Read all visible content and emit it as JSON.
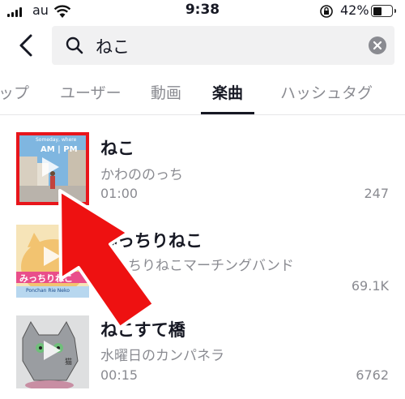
{
  "status_bar": {
    "carrier": "au",
    "time": "9:38",
    "battery_pct": "42%",
    "battery_level": 0.42,
    "icons": [
      "signal-icon",
      "wifi-icon",
      "orientation-lock-icon",
      "battery-icon"
    ]
  },
  "search": {
    "query": "ねこ",
    "icons": [
      "back-icon",
      "search-icon",
      "clear-icon"
    ]
  },
  "tabs": [
    {
      "label": "ップ",
      "active": false
    },
    {
      "label": "ユーザー",
      "active": false
    },
    {
      "label": "動画",
      "active": false
    },
    {
      "label": "楽曲",
      "active": true
    },
    {
      "label": "ハッシュタグ",
      "active": false
    }
  ],
  "songs": [
    {
      "title": "ねこ",
      "artist": "かわののっち",
      "duration": "01:00",
      "count": "247",
      "cover_text": "AM | PM",
      "cover_small": "Someday, where"
    },
    {
      "title": "みっちりねこ",
      "artist": "みっちりねこマーチングバンド",
      "duration": "",
      "count": "69.1K",
      "cover_text": "みっちりねこ",
      "cover_small": "Ponchan Rie Neko"
    },
    {
      "title": "ねこすて橋",
      "artist": "水曜日のカンパネラ",
      "duration": "00:15",
      "count": "6762",
      "cover_text": "",
      "cover_small": "猫"
    }
  ],
  "colors": {
    "annotation_red": "#ee1111",
    "text_primary": "#161823",
    "text_secondary": "#8a8b91"
  }
}
